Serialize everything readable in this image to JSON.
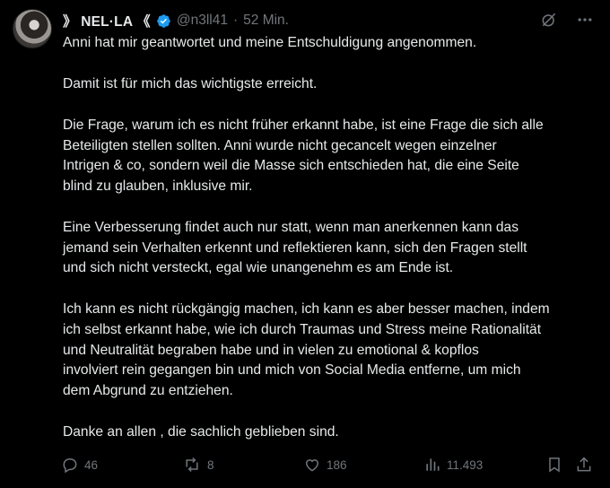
{
  "author": {
    "display_name": "》 NEL·LA 《",
    "handle": "@n3ll41",
    "separator": "·",
    "time": "52 Min."
  },
  "tweet": {
    "paragraphs": [
      "Anni hat mir geantwortet und meine Entschuldigung angenommen.",
      "Damit ist für mich das wichtigste erreicht.",
      "Die Frage, warum ich es nicht früher erkannt habe, ist eine Frage die sich alle\nBeteiligten stellen sollten. Anni wurde nicht gecancelt wegen einzelner\nIntrigen & co, sondern weil die Masse sich entschieden hat, die eine Seite\nblind zu glauben, inklusive mir.",
      "Eine Verbesserung findet auch nur statt, wenn man anerkennen kann das\njemand sein Verhalten erkennt und reflektieren kann, sich den Fragen stellt\nund sich nicht versteckt, egal wie unangenehm es am Ende ist.",
      "Ich kann es nicht rückgängig machen, ich kann es aber besser machen, indem\nich selbst erkannt habe, wie ich durch Traumas und Stress meine Rationalität\nund Neutralität begraben habe und in vielen zu emotional & kopflos\ninvolviert rein gegangen bin und mich von Social Media entferne, um mich\ndem Abgrund zu entziehen.",
      "Danke an allen , die sachlich geblieben sind."
    ]
  },
  "stats": {
    "replies": "46",
    "reposts": "8",
    "likes": "186",
    "views": "11.493"
  },
  "colors": {
    "background": "#000000",
    "text": "#e7e9ea",
    "muted": "#71767b",
    "verified": "#1d9bf0"
  },
  "icons": [
    "verified-badge-icon",
    "grok-icon",
    "more-icon",
    "reply-icon",
    "repost-icon",
    "like-icon",
    "views-icon",
    "bookmark-icon",
    "share-icon"
  ]
}
